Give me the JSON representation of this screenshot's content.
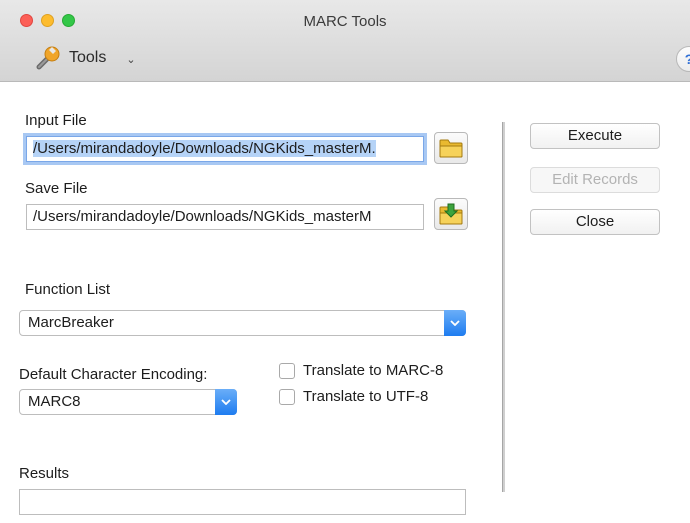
{
  "window": {
    "title": "MARC Tools"
  },
  "toolbar": {
    "tools_label": "Tools",
    "help_label": "?"
  },
  "form": {
    "input_file_label": "Input File",
    "input_file_value": "/Users/mirandadoyle/Downloads/NGKids_masterM.",
    "save_file_label": "Save File",
    "save_file_value": "/Users/mirandadoyle/Downloads/NGKids_masterM",
    "function_list_label": "Function List",
    "function_list_value": "MarcBreaker",
    "encoding_label": "Default Character Encoding:",
    "encoding_value": "MARC8",
    "translate_marc8_label": "Translate to MARC-8",
    "translate_utf8_label": "Translate to UTF-8",
    "results_label": "Results"
  },
  "actions": {
    "execute": "Execute",
    "edit_records": "Edit Records",
    "close": "Close"
  },
  "colors": {
    "accent": "#1e7cf0",
    "focus_ring": "#a8c8f3",
    "close_dot": "#fc5f57",
    "minimize_dot": "#fdbc2e",
    "maximize_dot": "#33c748"
  }
}
